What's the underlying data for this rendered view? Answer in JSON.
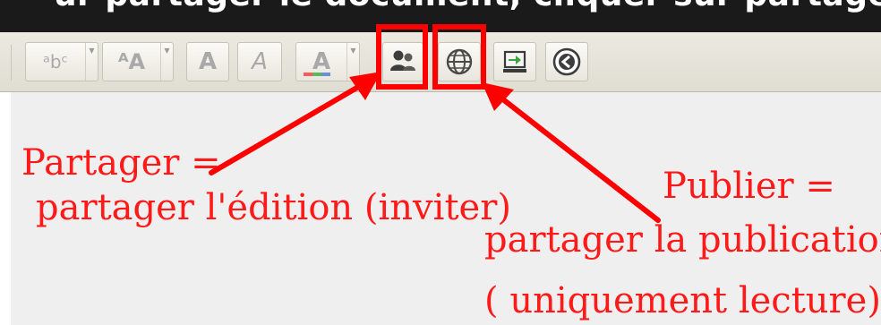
{
  "title_fragment": "ur partager le document, cliquer sur partager",
  "toolbar": {
    "buttons": [
      {
        "name": "superscript-button",
        "glyph": "ᵃbᶜ",
        "dropdown": true
      },
      {
        "name": "font-size-button",
        "glyph": "ᴬA",
        "dropdown": true
      },
      {
        "name": "bold-button",
        "glyph": "A",
        "dropdown": false
      },
      {
        "name": "italic-button",
        "glyph": "A",
        "dropdown": false
      },
      {
        "name": "text-color-button",
        "glyph": "A",
        "dropdown": true
      }
    ],
    "color_bar": [
      "#ff5a5a",
      "#5cb85c",
      "#6b8fd6"
    ],
    "icons": {
      "share": "share-users-icon",
      "publish": "globe-icon",
      "export": "export-icon",
      "back": "back-circle-icon"
    },
    "highlight_color": "#ff0000"
  },
  "annotations": {
    "share_line1": "Partager =",
    "share_line2": "partager l'édition (inviter)",
    "publish_line1": "Publier =",
    "publish_line2": "partager la publication",
    "publish_line3": "( uniquement lecture)"
  }
}
